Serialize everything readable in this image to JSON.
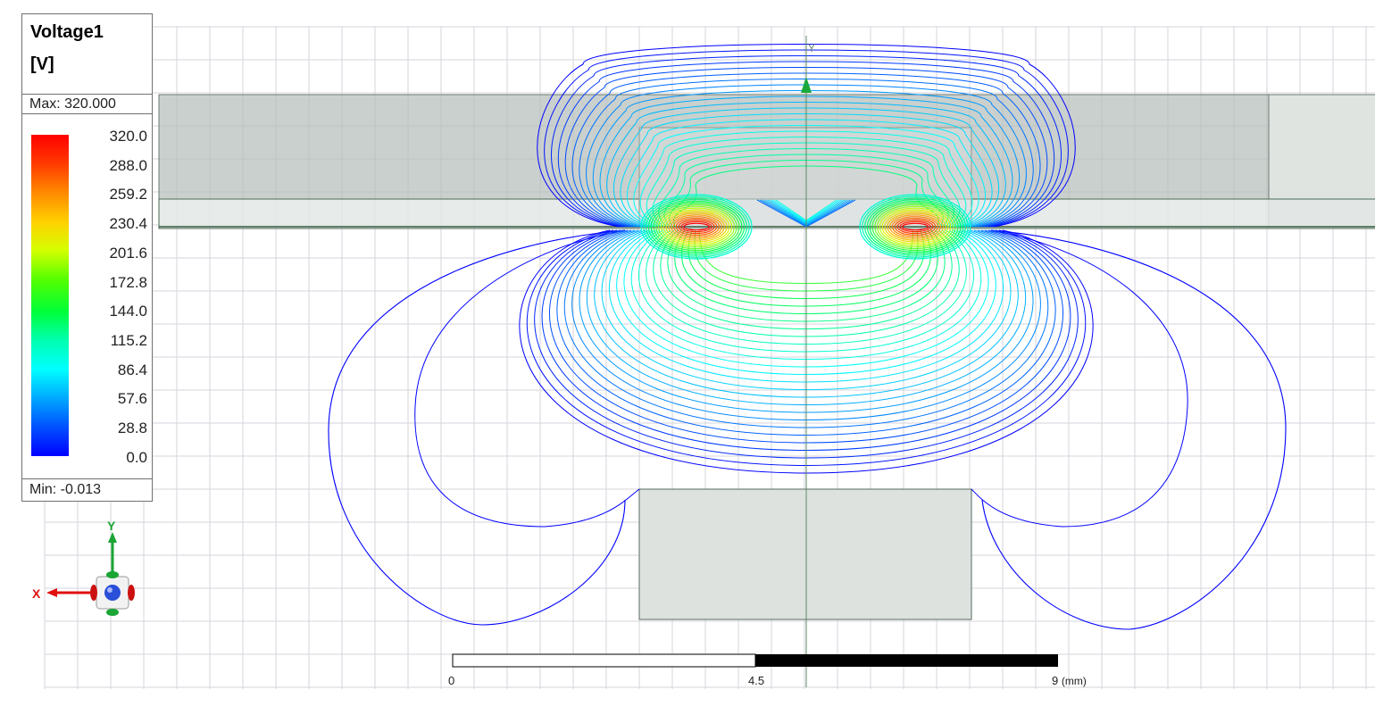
{
  "legend": {
    "title": "Voltage1",
    "unit": "[V]",
    "max_label": "Max: 320.000",
    "min_label": "Min:  -0.013",
    "ticks": [
      "320.0",
      "288.0",
      "259.2",
      "230.4",
      "201.6",
      "172.8",
      "144.0",
      "115.2",
      "86.4",
      "57.6",
      "28.8",
      "0.0"
    ]
  },
  "axes": {
    "x_label": "X",
    "y_label": "Y",
    "view_axis_y": "Y"
  },
  "scale_bar": {
    "left_label": "0",
    "mid_label": "4.5",
    "right_label": "9",
    "unit": "(mm)"
  },
  "colors": {
    "contour_low": "#0000ff",
    "contour_high": "#ff0000",
    "grid": "#d4d4dc",
    "solid_fill": "#c9d2cc"
  }
}
